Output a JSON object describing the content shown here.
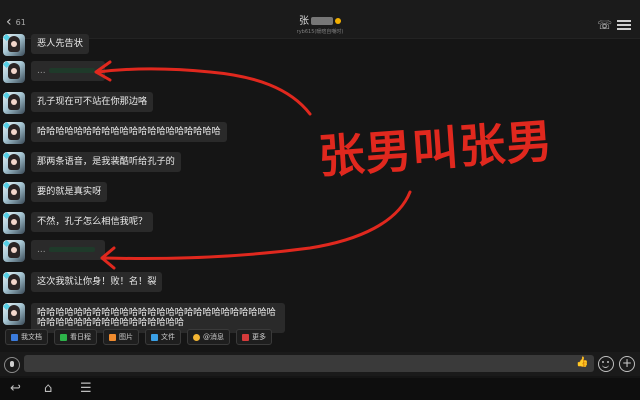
{
  "header": {
    "back_badge": "61",
    "title": "张",
    "subtitle": "ryb615(暖暄自嘲时)"
  },
  "messages": [
    {
      "text": "恶人先告状"
    },
    {
      "text": "..."
    },
    {
      "text": "孔子现在可不站在你那边咯"
    },
    {
      "text": "哈哈哈哈哈哈哈哈哈哈哈哈哈哈哈哈哈哈哈哈"
    },
    {
      "text": "那两条语音，是我装酷听给孔子的"
    },
    {
      "text": "要的就是真实呀"
    },
    {
      "text": "不然，孔子怎么相信我呢？"
    },
    {
      "text": "..."
    },
    {
      "text": "这次我就让你身！败！名！裂"
    },
    {
      "text": "哈哈哈哈哈哈哈哈哈哈哈哈哈哈哈哈哈哈哈哈哈哈哈哈哈哈哈哈哈哈哈哈哈哈哈哈哈哈哈哈哈哈"
    }
  ],
  "toolbar": [
    {
      "label": "我文档",
      "icon": "document-icon"
    },
    {
      "label": "看日程",
      "icon": "calendar-icon"
    },
    {
      "label": "图片",
      "icon": "image-icon"
    },
    {
      "label": "文件",
      "icon": "file-icon"
    },
    {
      "label": "@消息",
      "icon": "at-icon"
    },
    {
      "label": "更多",
      "icon": "more-icon"
    }
  ],
  "annotation": {
    "text": "张男叫张男",
    "color": "#e0281e"
  }
}
